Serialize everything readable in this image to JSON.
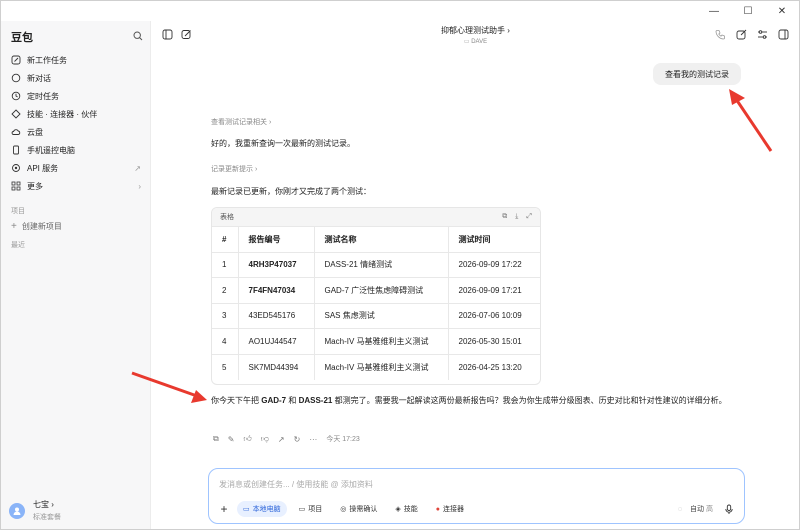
{
  "app": {
    "name": "豆包"
  },
  "sidebar": {
    "items": [
      {
        "label": "新工作任务",
        "icon": "edit-icon"
      },
      {
        "label": "新对话",
        "icon": "chat-icon"
      },
      {
        "label": "定时任务",
        "icon": "clock-icon"
      },
      {
        "label": "技能 · 连接器 · 伙伴",
        "icon": "skills-icon"
      },
      {
        "label": "云盘",
        "icon": "cloud-icon"
      },
      {
        "label": "手机遥控电脑",
        "icon": "phone-icon"
      },
      {
        "label": "API 服务",
        "icon": "api-icon",
        "trail": "↗"
      },
      {
        "label": "更多",
        "icon": "grid-icon",
        "trail": "›"
      }
    ],
    "section_label": "项目",
    "create_project": "创建新项目",
    "recent_label": "最近",
    "user": {
      "name": "七宝 ›",
      "plan": "标准套餐"
    }
  },
  "topbar": {
    "title": "抑郁心理测试助手 ›",
    "subtitle": "DAVE"
  },
  "chat": {
    "user_message": "查看我的测试记录",
    "meta1": "查看测试记录相关 ›",
    "reply1": "好的，我重新查询一次最新的测试记录。",
    "meta2": "记录更新提示 ›",
    "reply2": "最新记录已更新，你刚才又完成了两个测试：",
    "table": {
      "caption": "表格",
      "headers": [
        "#",
        "报告编号",
        "测试名称",
        "测试时间"
      ],
      "rows": [
        [
          "1",
          "4RH3P47037",
          "DASS-21 情绪测试",
          "2026-09-09 17:22"
        ],
        [
          "2",
          "7F4FN47034",
          "GAD-7 广泛性焦虑障碍测试",
          "2026-09-09 17:21"
        ],
        [
          "3",
          "43ED545176",
          "SAS 焦虑测试",
          "2026-07-06 10:09"
        ],
        [
          "4",
          "AO1UJ44547",
          "Mach-IV 马基雅维利主义测试",
          "2026-05-30 15:01"
        ],
        [
          "5",
          "SK7MD44394",
          "Mach-IV 马基雅维利主义测试",
          "2026-04-25 13:20"
        ]
      ]
    },
    "answer": {
      "part1": "你今天下午把 ",
      "bold1": "GAD-7",
      "part2": " 和 ",
      "bold2": "DASS-21",
      "part3": " 都测完了。需要我一起解读这两份最新报告吗？我会为你生成带分级图表、历史对比和针对性建议的详细分析。"
    },
    "timestamp": "今天 17:23"
  },
  "composer": {
    "placeholder": "发消息或创建任务... / 使用技能 @ 添加资料",
    "chips": [
      "本地电脑",
      "项目",
      "操需确认",
      "技能",
      "连接器"
    ],
    "mode": "自动",
    "mode_suffix": "高"
  }
}
